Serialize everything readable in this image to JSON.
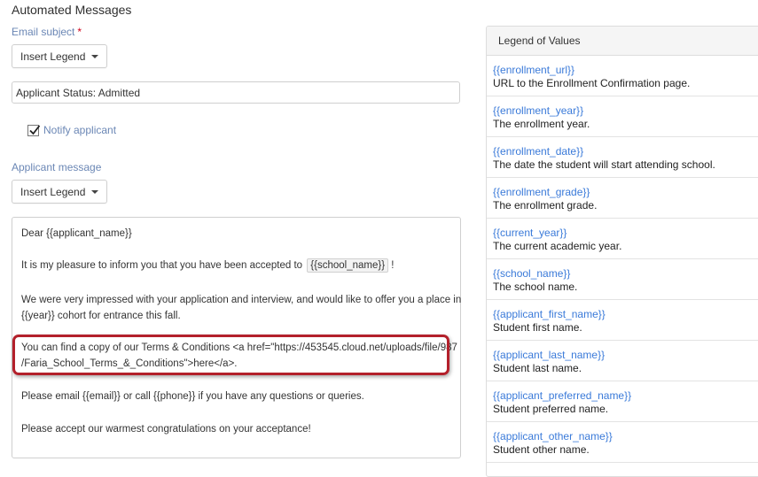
{
  "section": {
    "title": "Automated Messages"
  },
  "email_subject": {
    "label": "Email subject",
    "required_mark": "*",
    "insert_legend_label": "Insert Legend",
    "value": "Applicant Status: Admitted"
  },
  "notify": {
    "label": "Notify applicant",
    "checked": true
  },
  "applicant_message": {
    "label": "Applicant message",
    "insert_legend_label": "Insert Legend",
    "lines": {
      "greeting": "Dear {{applicant_name}}",
      "accepted_prefix": "It is my pleasure to inform you that you have been accepted to",
      "accepted_token": "{{school_name}}",
      "accepted_suffix": "!",
      "impressed_1": "We were very impressed with your application and interview, and would like to offer you a place in",
      "impressed_2": "{{year}} cohort for entrance this fall.",
      "terms_1": "You can find a copy of our Terms & Conditions <a href=\"https://453545.cloud.net/uploads/file/987",
      "terms_2": "/Faria_School_Terms_&_Conditions\">here</a>.",
      "contact": "Please email {{email}} or call {{phone}} if you have any questions or queries.",
      "congrats": "Please accept our warmest congratulations on your acceptance!"
    }
  },
  "legend": {
    "title": "Legend of Values",
    "items": [
      {
        "key": "{{enrollment_url}}",
        "desc": "URL to the Enrollment Confirmation page."
      },
      {
        "key": "{{enrollment_year}}",
        "desc": "The enrollment year."
      },
      {
        "key": "{{enrollment_date}}",
        "desc": "The date the student will start attending school."
      },
      {
        "key": "{{enrollment_grade}}",
        "desc": "The enrollment grade."
      },
      {
        "key": "{{current_year}}",
        "desc": "The current academic year."
      },
      {
        "key": "{{school_name}}",
        "desc": "The school name."
      },
      {
        "key": "{{applicant_first_name}}",
        "desc": "Student first name."
      },
      {
        "key": "{{applicant_last_name}}",
        "desc": "Student last name."
      },
      {
        "key": "{{applicant_preferred_name}}",
        "desc": "Student preferred name."
      },
      {
        "key": "{{applicant_other_name}}",
        "desc": "Student other name."
      }
    ]
  },
  "colors": {
    "label": "#6b87b5",
    "link": "#3a7ad9",
    "highlight": "#b3202b"
  }
}
